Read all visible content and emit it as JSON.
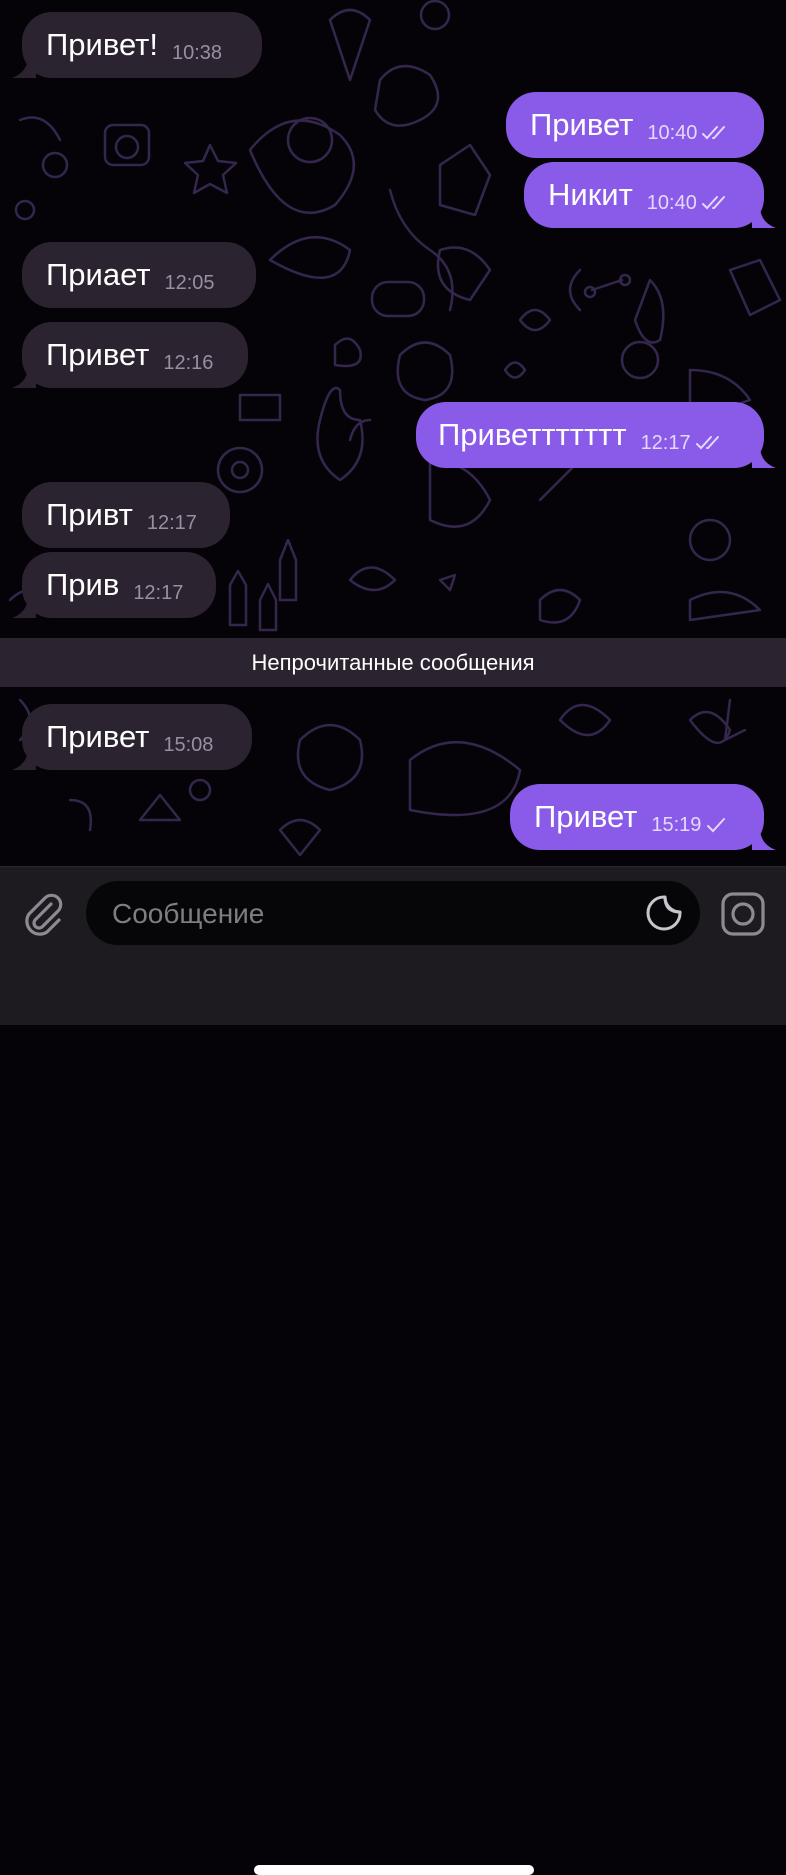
{
  "messages": [
    {
      "direction": "in",
      "text": "Привет!",
      "time": "10:38"
    },
    {
      "direction": "out",
      "text": "Привет",
      "time": "10:40",
      "status": "read"
    },
    {
      "direction": "out",
      "text": "Никит",
      "time": "10:40",
      "status": "read"
    },
    {
      "direction": "in",
      "text": "Приает",
      "time": "12:05"
    },
    {
      "direction": "in",
      "text": "Привет",
      "time": "12:16"
    },
    {
      "direction": "out",
      "text": "Приветтттттт",
      "time": "12:17",
      "status": "read"
    },
    {
      "direction": "in",
      "text": "Привт",
      "time": "12:17"
    },
    {
      "direction": "in",
      "text": "Прив",
      "time": "12:17"
    },
    {
      "direction": "in",
      "text": "Привет",
      "time": "15:08"
    },
    {
      "direction": "out",
      "text": "Привет",
      "time": "15:19",
      "status": "sent"
    }
  ],
  "unread_divider": "Непрочитанные сообщения",
  "composer": {
    "placeholder": "Сообщение",
    "attach_icon": "paperclip-icon",
    "sticker_icon": "sticker-icon",
    "camera_icon": "camera-icon"
  },
  "colors": {
    "incoming_bubble": "#2b2330",
    "outgoing_bubble": "#8a5ae8",
    "background": "#050308",
    "wallpaper_doodle": "#3b2a55"
  }
}
